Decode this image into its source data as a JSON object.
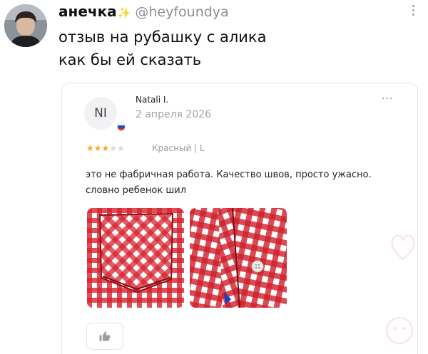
{
  "tweet": {
    "display_name": "анечка",
    "sparkle": "✨",
    "handle": "@heyfoundya",
    "lines": [
      "отзыв на рубашку с алика",
      "как бы ей сказать"
    ]
  },
  "review": {
    "avatar_initials": "NI",
    "name": "Natali I.",
    "date": "2 апреля 2026",
    "more": "···",
    "rating": 3,
    "rating_max": 5,
    "variant": "Красный | L",
    "text": "это не фабричная работа. Качество швов, просто ужасно. словно ребенок шил",
    "like_icon": "thumbs-up-icon"
  },
  "colors": {
    "plaid_red": "#d8232e",
    "plaid_white": "#ffffff",
    "star": "#f5a623",
    "handle_gray": "#8a8f95"
  }
}
